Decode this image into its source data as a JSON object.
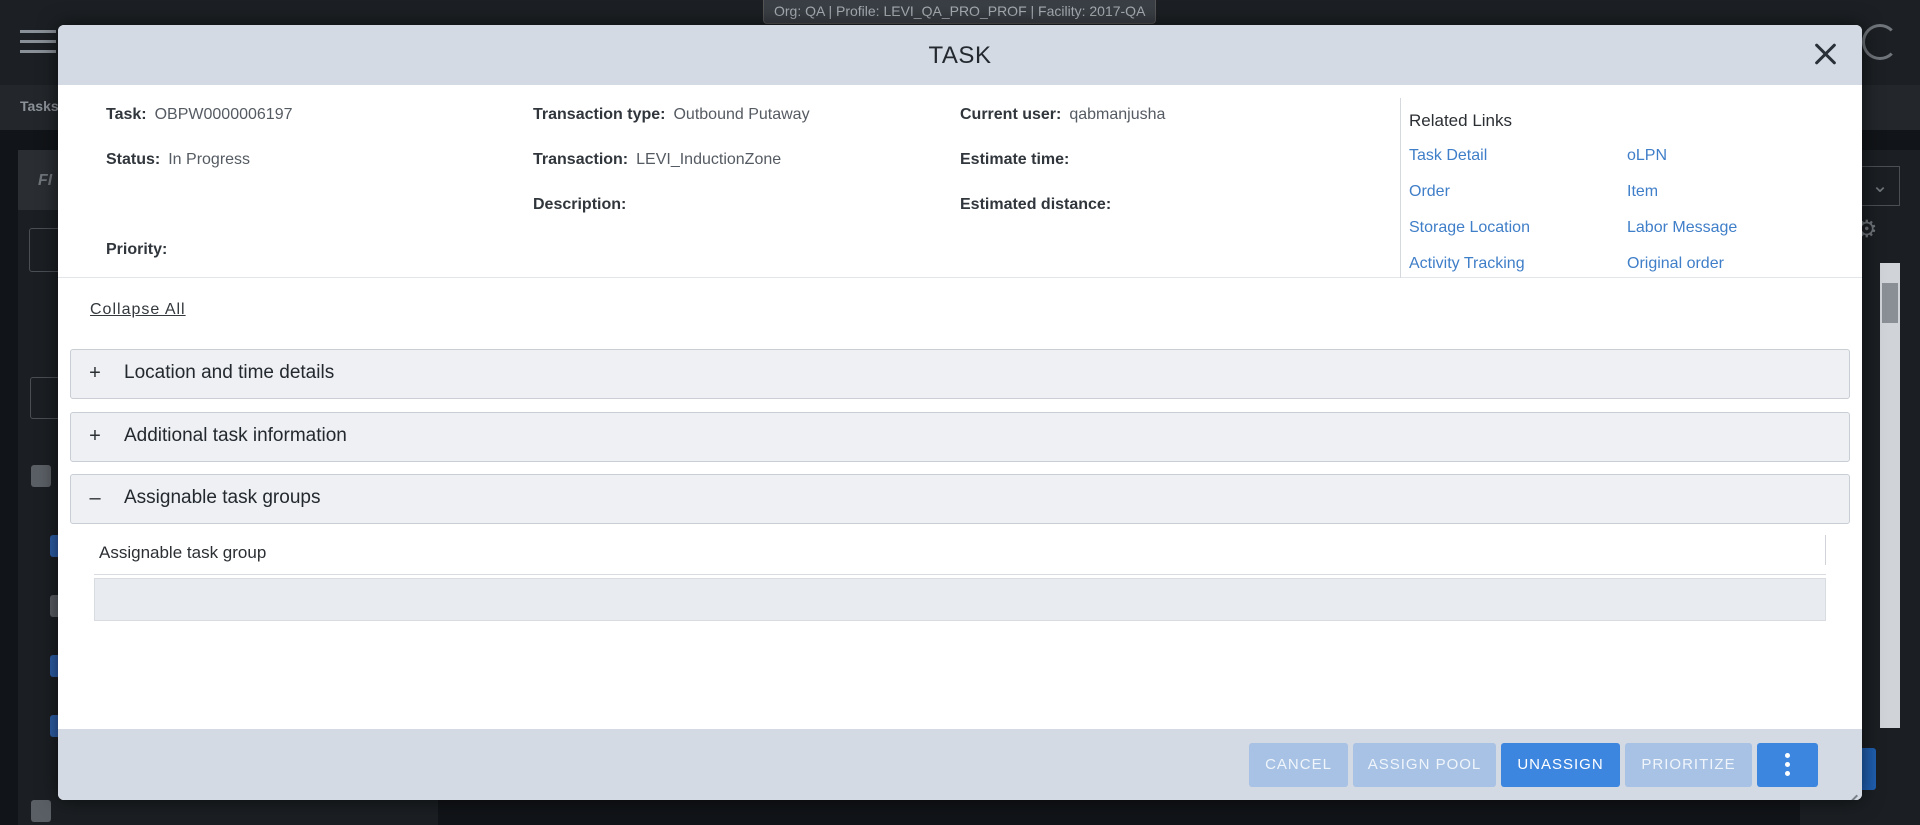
{
  "context_bar": "Org: QA  |  Profile: LEVI_QA_PRO_PROF  |  Facility: 2017-QA",
  "background": {
    "breadcrumb": "Tasks",
    "filter_label": "FI"
  },
  "modal": {
    "title": "TASK",
    "fields": {
      "task": {
        "label": "Task:",
        "value": "OBPW0000006197"
      },
      "status": {
        "label": "Status:",
        "value": "In Progress"
      },
      "priority": {
        "label": "Priority:",
        "value": ""
      },
      "transaction_type": {
        "label": "Transaction type:",
        "value": "Outbound Putaway"
      },
      "transaction": {
        "label": "Transaction:",
        "value": "LEVI_InductionZone"
      },
      "description": {
        "label": "Description:",
        "value": ""
      },
      "current_user": {
        "label": "Current user:",
        "value": "qabmanjusha"
      },
      "estimate_time": {
        "label": "Estimate time:",
        "value": ""
      },
      "estimated_distance": {
        "label": "Estimated distance:",
        "value": ""
      }
    },
    "related_links": {
      "title": "Related Links",
      "items": [
        "Task Detail",
        "oLPN",
        "Order",
        "Item",
        "Storage Location",
        "Labor Message",
        "Activity Tracking",
        "Original order"
      ]
    },
    "collapse_all": "Collapse All",
    "sections": [
      {
        "title": "Location and time details",
        "sign": "+"
      },
      {
        "title": "Additional task information",
        "sign": "+"
      },
      {
        "title": "Assignable task groups",
        "sign": "–"
      }
    ],
    "table": {
      "columns": [
        "Assignable task group"
      ]
    },
    "buttons": {
      "cancel": "CANCEL",
      "assign_pool": "ASSIGN POOL",
      "unassign": "UNASSIGN",
      "prioritize": "PRIORITIZE"
    }
  },
  "colors": {
    "header_bg": "#d4dae3",
    "link": "#3f7ec8",
    "primary_button": "#3d86df",
    "disabled_button": "#a7c2e4"
  }
}
